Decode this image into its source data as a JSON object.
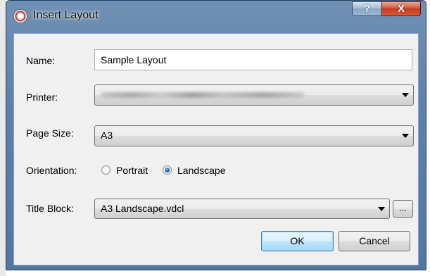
{
  "window": {
    "title": "Insert Layout",
    "help_label": "?",
    "close_label": "X"
  },
  "form": {
    "name_label": "Name:",
    "name_value": "Sample Layout",
    "printer_label": "Printer:",
    "printer_value": "",
    "page_size_label": "Page Size:",
    "page_size_value": "A3",
    "orientation_label": "Orientation:",
    "orientation_options": [
      "Portrait",
      "Landscape"
    ],
    "orientation_selected": "Landscape",
    "title_block_label": "Title Block:",
    "title_block_value": "A3 Landscape.vdcl",
    "browse_label": "..."
  },
  "buttons": {
    "ok_label": "OK",
    "cancel_label": "Cancel"
  },
  "colors": {
    "title_bar": "#5f80a6",
    "client_bg": "#f0f0f0",
    "close_button": "#c23a21",
    "default_button_border": "#3c7fb1"
  },
  "icons": {
    "app": "gear-icon",
    "combo_arrow": "chevron-down-icon",
    "radio_selected": "radio-checked-icon"
  }
}
